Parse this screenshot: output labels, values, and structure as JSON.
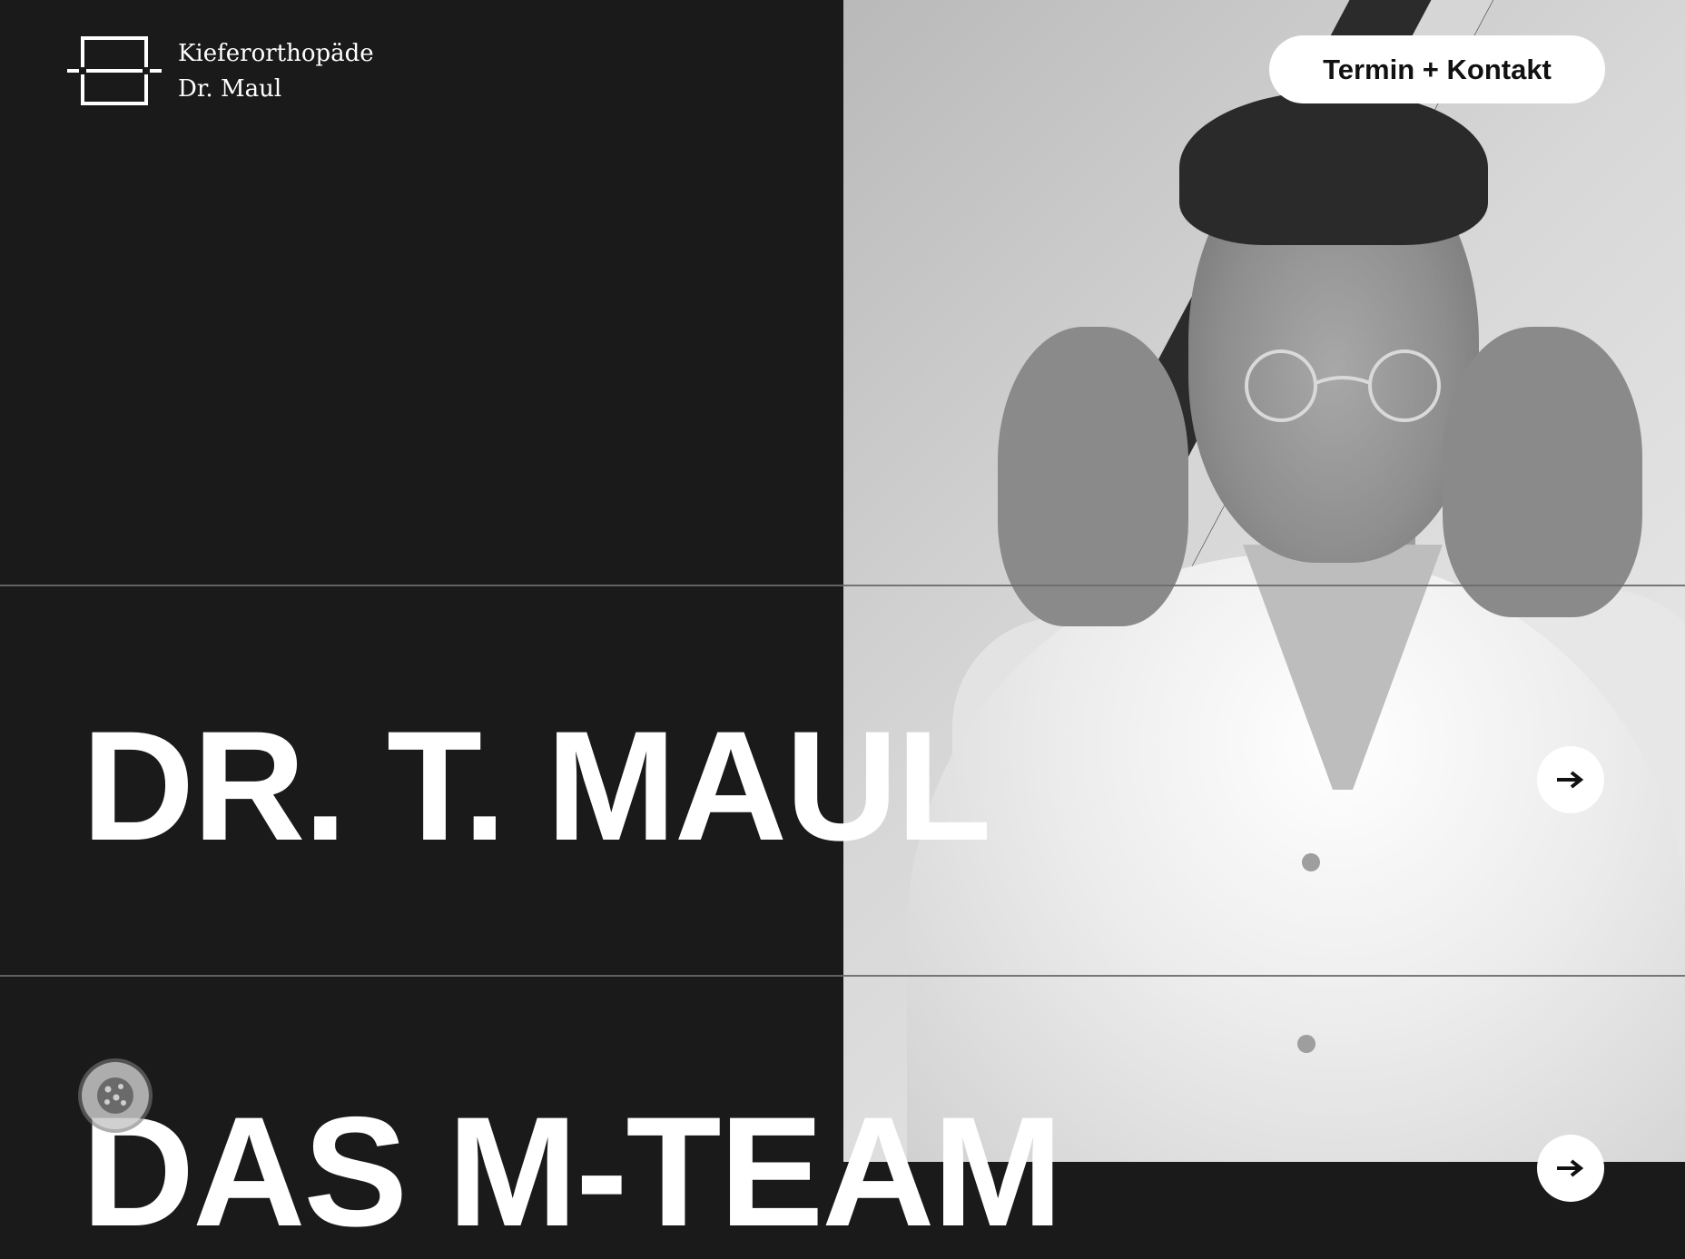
{
  "logo": {
    "line1": "Kieferorthopäde",
    "line2": "Dr. Maul",
    "icon": "bracket-square-logo"
  },
  "header": {
    "cta_label": "Termin + Kontakt"
  },
  "hero": {
    "item1": {
      "title": "DR. T. MAUL",
      "icon": "arrow-right-icon"
    },
    "item2": {
      "title": "DAS M-TEAM",
      "icon": "arrow-right-icon"
    }
  },
  "cookie": {
    "icon": "cookie-icon"
  },
  "colors": {
    "background": "#1a1a1b",
    "text": "#ffffff",
    "button_bg": "#ffffff",
    "button_text": "#111111",
    "divider": "#6a6a6a"
  }
}
